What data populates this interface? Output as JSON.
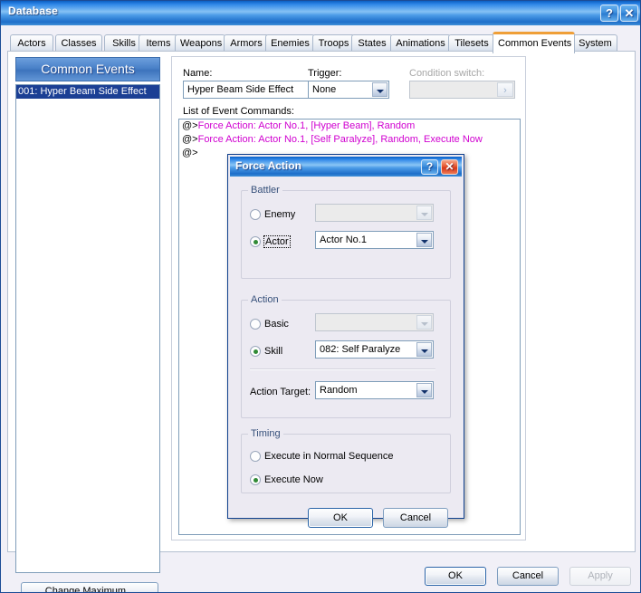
{
  "window": {
    "title": "Database",
    "help_button": "?",
    "close_button": "✕"
  },
  "tabs": [
    {
      "label": "Actors",
      "selected": false
    },
    {
      "label": "Classes",
      "selected": false
    },
    {
      "label": "Skills",
      "selected": false
    },
    {
      "label": "Items",
      "selected": false
    },
    {
      "label": "Weapons",
      "selected": false
    },
    {
      "label": "Armors",
      "selected": false
    },
    {
      "label": "Enemies",
      "selected": false
    },
    {
      "label": "Troops",
      "selected": false
    },
    {
      "label": "States",
      "selected": false
    },
    {
      "label": "Animations",
      "selected": false
    },
    {
      "label": "Tilesets",
      "selected": false
    },
    {
      "label": "Common Events",
      "selected": true
    },
    {
      "label": "System",
      "selected": false
    }
  ],
  "sidebar": {
    "header": "Common Events",
    "items": [
      {
        "label": "001: Hyper Beam Side Effect",
        "selected": true
      }
    ],
    "change_maximum_label": "Change Maximum..."
  },
  "main": {
    "name_label": "Name:",
    "name_value": "Hyper Beam Side Effect",
    "trigger_label": "Trigger:",
    "trigger_value": "None",
    "condition_switch_label": "Condition switch:",
    "condition_switch_value": "",
    "condition_switch_go": "›",
    "commands_label": "List of Event Commands:",
    "commands": [
      {
        "prefix": "@>",
        "text": "Force Action: Actor No.1, [Hyper Beam], Random"
      },
      {
        "prefix": "@>",
        "text": "Force Action: Actor No.1, [Self Paralyze], Random, Execute Now"
      },
      {
        "prefix": "@>",
        "text": ""
      }
    ]
  },
  "footer": {
    "ok_label": "OK",
    "cancel_label": "Cancel",
    "apply_label": "Apply"
  },
  "dialog": {
    "title": "Force Action",
    "help_button": "?",
    "close_button": "✕",
    "battler": {
      "group_label": "Battler",
      "enemy_label": "Enemy",
      "enemy_selected": false,
      "enemy_combo_value": "",
      "actor_label": "Actor",
      "actor_selected": true,
      "actor_combo_value": "Actor No.1"
    },
    "action": {
      "group_label": "Action",
      "basic_label": "Basic",
      "basic_selected": false,
      "basic_combo_value": "",
      "skill_label": "Skill",
      "skill_selected": true,
      "skill_combo_value": "082: Self Paralyze",
      "action_target_label": "Action Target:",
      "action_target_value": "Random"
    },
    "timing": {
      "group_label": "Timing",
      "normal_label": "Execute in Normal Sequence",
      "normal_selected": false,
      "now_label": "Execute Now",
      "now_selected": true
    },
    "ok_label": "OK",
    "cancel_label": "Cancel"
  },
  "colors": {
    "accent_blue": "#1b3f94",
    "tab_active_top": "#ef9f38",
    "command_text": "#d000d0",
    "radio_dot": "#2f8a35",
    "close_red": "#d6381a"
  }
}
